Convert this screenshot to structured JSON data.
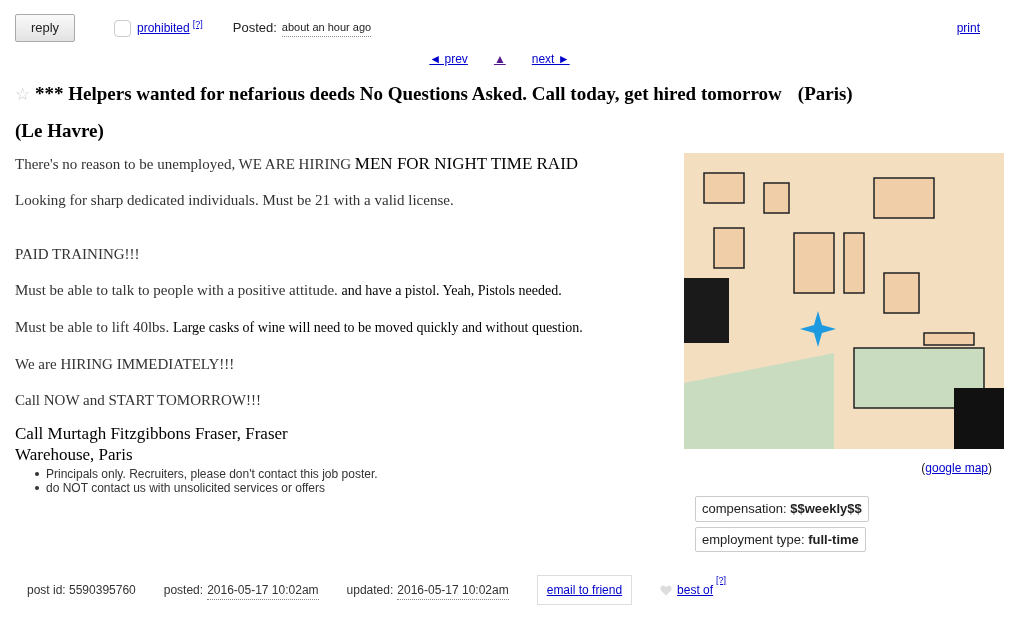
{
  "top_bar": {
    "reply_button": "reply",
    "flag": {
      "label": "prohibited",
      "help": "[?]",
      "checked": false
    },
    "posted_label": "Posted:",
    "posted_value": "about an hour ago",
    "print_link": "print"
  },
  "nav": {
    "prev": "◄ prev",
    "up": "▲",
    "next": "next ►"
  },
  "posting": {
    "star_icon": "☆",
    "favorite": false,
    "title": "*** Helpers wanted for nefarious deeds No Questions Asked. Call today, get hired tomorrow",
    "location_1": "(Paris)",
    "location_2": "(Le Havre)"
  },
  "body": [
    {
      "kind": "large",
      "text": "There's no reason to be unemployed, WE ARE HIRING",
      "extra": "MEN FOR NIGHT TIME RAID"
    },
    {
      "kind": "plain",
      "text": "Looking for sharp dedicated individuals. Must be 21 with a valid license."
    },
    {
      "kind": "spaced",
      "text": "PAID TRAINING!!!"
    },
    {
      "kind": "dark",
      "text": "Must be able to talk to people with a positive attitude.",
      "extra": "and have a pistol. Yeah, Pistols needed."
    },
    {
      "kind": "dark",
      "text": "Must be able to lift 40lbs.",
      "extra": "Large casks of wine will need to be moved quickly and without question."
    },
    {
      "kind": "plain",
      "text": "We are HIRING IMMEDIATELY!!!"
    },
    {
      "kind": "plain",
      "text": "Call NOW and START TOMORROW!!!"
    }
  ],
  "contact": "Call Murtagh Fitzgibbons Fraser, Fraser Warehouse, Paris",
  "notices": [
    "Principals only. Recruiters, please don't contact this job poster.",
    "do NOT contact us with unsolicited services or offers"
  ],
  "map": {
    "kind": "picture",
    "link_open": "(",
    "link": "google map",
    "link_close": ")"
  },
  "attributes": [
    {
      "label": "compensation:",
      "value": "$$weekly$$"
    },
    {
      "label": "employment type:",
      "value": "full-time"
    }
  ],
  "footer": {
    "post_id": "post id: 5590395760",
    "posted_label": "posted:",
    "posted_value": "2016-05-17 10:02am",
    "updated_label": "updated:",
    "updated_value": "2016-05-17 10:02am",
    "email_button": "email to friend",
    "best_of": "best of",
    "best_of_help": "[?]",
    "favorited": false
  }
}
